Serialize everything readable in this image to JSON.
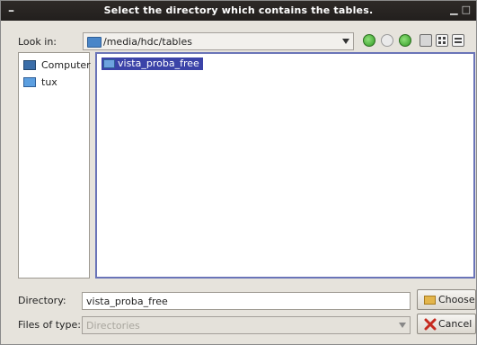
{
  "window": {
    "title": "Select the directory which contains the tables."
  },
  "lookin": {
    "label": "Look in:",
    "path": "/media/hdc/tables"
  },
  "sidebar": {
    "items": [
      {
        "label": "Computer"
      },
      {
        "label": "tux"
      }
    ]
  },
  "files": [
    {
      "name": "vista_proba_free"
    }
  ],
  "directory": {
    "label": "Directory:",
    "value": "vista_proba_free"
  },
  "filetype": {
    "label": "Files of type:",
    "value": "Directories"
  },
  "buttons": {
    "choose": "Choose",
    "cancel": "Cancel"
  },
  "icons": {
    "back": "go-back-icon",
    "forward": "go-forward-icon",
    "up": "go-up-icon",
    "new_folder": "new-folder-icon",
    "list_view": "list-view-icon",
    "detail_view": "detail-view-icon"
  }
}
